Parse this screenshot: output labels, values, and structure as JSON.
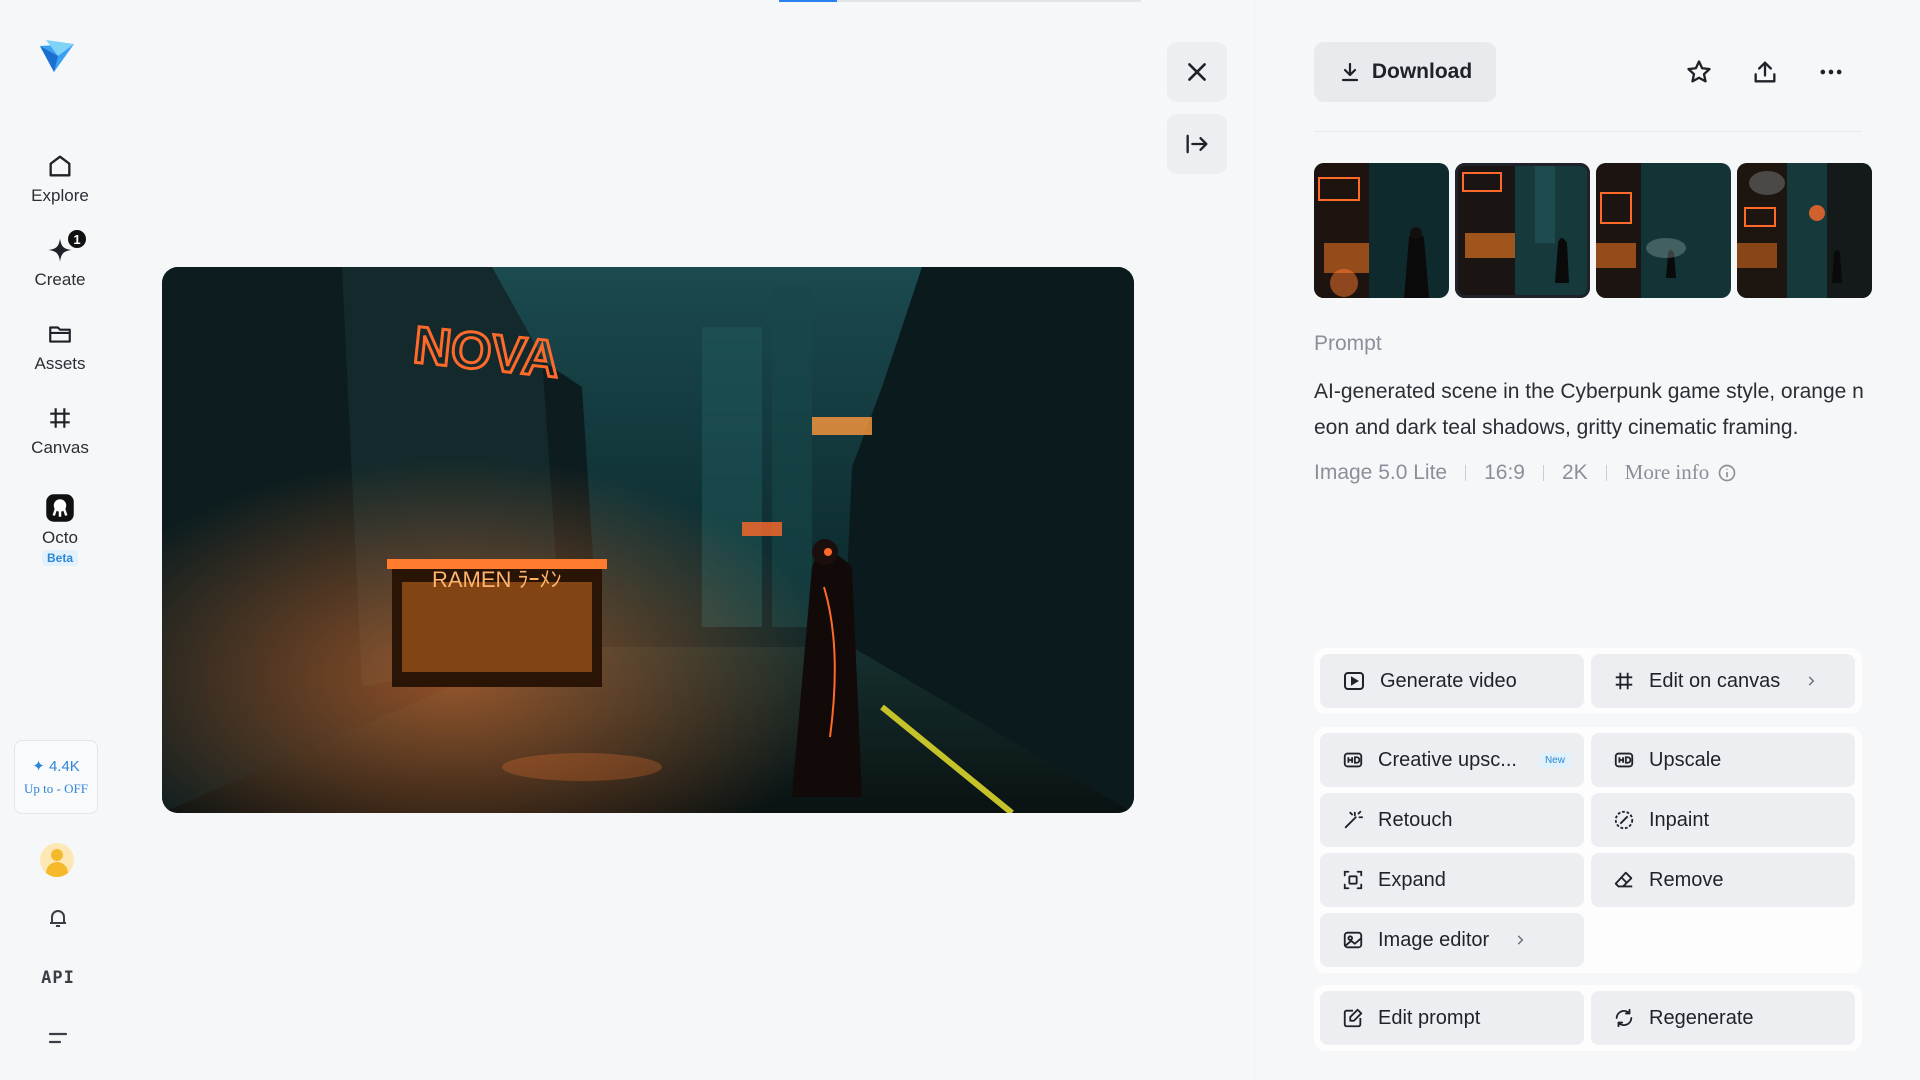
{
  "progress": {
    "fraction": 0.16
  },
  "sidebar": {
    "nav": [
      {
        "label": "Explore",
        "icon": "home-icon"
      },
      {
        "label": "Create",
        "icon": "sparkle-icon",
        "badge": "1"
      },
      {
        "label": "Assets",
        "icon": "folder-icon"
      },
      {
        "label": "Canvas",
        "icon": "canvas-icon"
      },
      {
        "label": "Octo",
        "icon": "octo-icon",
        "tag": "Beta"
      }
    ],
    "credits": {
      "amount": "✦ 4.4K",
      "offer": "Up to - OFF"
    },
    "api_label": "API"
  },
  "toolbar": {
    "download_label": "Download"
  },
  "panel": {
    "prompt_heading": "Prompt",
    "prompt_text": "AI-generated scene in the Cyberpunk game style, orange neon and dark teal shadows, gritty cinematic framing.",
    "meta": {
      "model": "Image 5.0 Lite",
      "ratio": "16:9",
      "resolution": "2K",
      "more_info": "More info"
    },
    "selected_thumbnail": 2
  },
  "actions": {
    "generate_video": "Generate video",
    "edit_on_canvas": "Edit on canvas",
    "creative_upscale": "Creative upsc...",
    "new_tag": "New",
    "upscale": "Upscale",
    "retouch": "Retouch",
    "inpaint": "Inpaint",
    "expand": "Expand",
    "remove": "Remove",
    "image_editor": "Image editor",
    "edit_prompt": "Edit prompt",
    "regenerate": "Regenerate"
  },
  "image_text": {
    "sign_top": "NOVA",
    "sign_shop": "RAMEN ﾗｰﾒﾝ"
  },
  "colors": {
    "accent": "#2b7ff0",
    "neon": "#ff6a2a",
    "teal": "#0f3b3c"
  }
}
